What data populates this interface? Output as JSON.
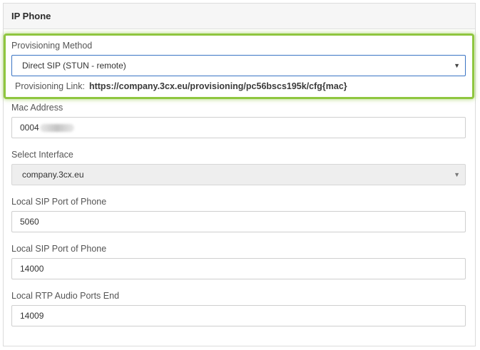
{
  "panel": {
    "title": "IP Phone"
  },
  "provisioning": {
    "label": "Provisioning Method",
    "selected": "Direct SIP (STUN - remote)",
    "link_label": "Provisioning Link:",
    "link_value": "https://company.3cx.eu/provisioning/pc56bscs195k/cfg{mac}",
    "highlight_color": "#8fc63f"
  },
  "mac_address": {
    "label": "Mac Address",
    "value": "0004"
  },
  "interface": {
    "label": "Select Interface",
    "selected": "company.3cx.eu"
  },
  "sip_port": {
    "label": "Local SIP Port of Phone",
    "value": "5060"
  },
  "sip_port_2": {
    "label": "Local SIP Port of Phone",
    "value": "14000"
  },
  "rtp_end": {
    "label": "Local RTP Audio Ports End",
    "value": "14009"
  },
  "icons": {
    "dropdown": "chevron-down-icon",
    "caret_glyph": "▼"
  }
}
